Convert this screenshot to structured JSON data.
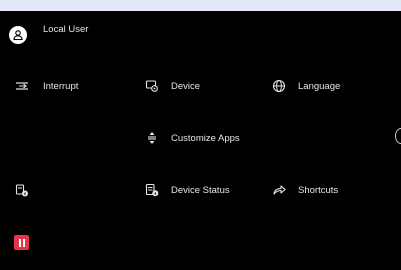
{
  "user": {
    "name": "Local User",
    "icon": "user-icon"
  },
  "menu": {
    "interrupt": {
      "label": "Interrupt",
      "icon": "interrupt-icon"
    },
    "device": {
      "label": "Device",
      "icon": "device-settings-icon"
    },
    "language": {
      "label": "Language",
      "icon": "globe-icon"
    },
    "customize_apps": {
      "label": "Customize Apps",
      "icon": "reorder-icon"
    },
    "device_status": {
      "label": "Device Status",
      "icon": "device-status-icon"
    },
    "shortcuts": {
      "label": "Shortcuts",
      "icon": "shortcut-arrow-icon"
    },
    "printer_status": {
      "icon": "printer-info-icon"
    },
    "pause": {
      "icon": "pause-icon",
      "color": "#e8344a"
    }
  },
  "colors": {
    "background": "#000000",
    "text": "#e6e6e6",
    "frame": "#e4e9f7"
  }
}
